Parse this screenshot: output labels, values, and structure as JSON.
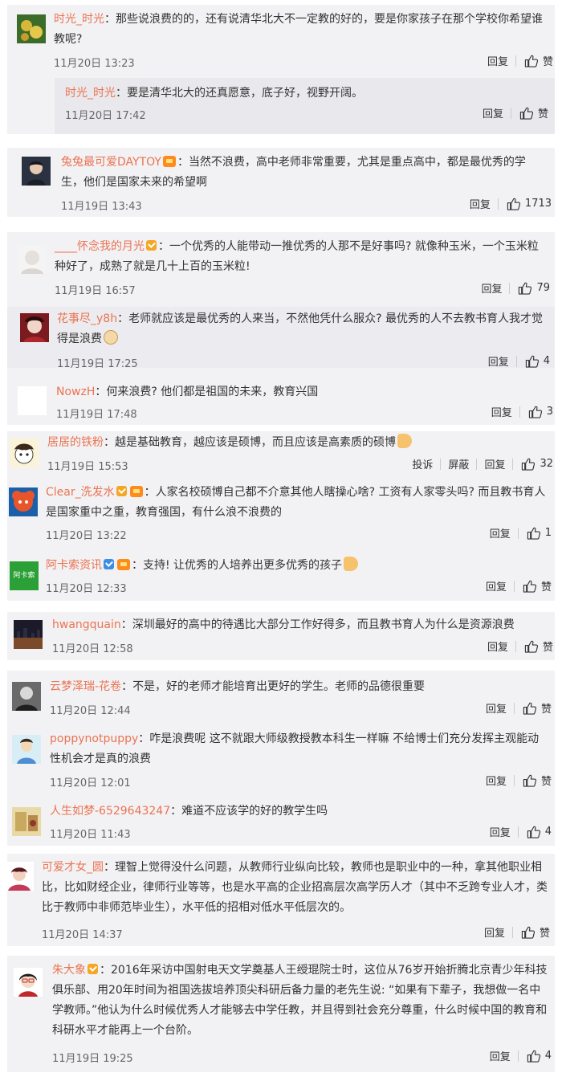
{
  "action_reply": "回复",
  "action_report": "投诉",
  "action_block": "屏蔽",
  "comments": [
    {
      "user": "时光_时光",
      "text": "那些说浪费的的，还有说清华北大不一定教的好的，要是你家孩子在那个学校你希望谁教呢?",
      "time": "11月20日 13:23",
      "likes": "赞"
    },
    {
      "user": "时光_时光",
      "text": "要是清华北大的还真愿意，底子好，视野开阔。",
      "time": "11月20日 17:42",
      "likes": "赞"
    },
    {
      "user": "兔兔最可爱DAYTOY",
      "text": "当然不浪费，高中老师非常重要，尤其是重点高中，都是最优秀的学生，他们是国家未来的希望啊",
      "time": "11月19日 13:43",
      "likes": "1713"
    },
    {
      "user": "____怀念我的月光",
      "text": "一个优秀的人能带动一推优秀的人那不是好事吗? 就像种玉米，一个玉米粒种好了，成熟了就是几十上百的玉米粒!",
      "time": "11月19日 16:57",
      "likes": "79"
    },
    {
      "user": "花事尽_y8h",
      "text": "老师就应该是最优秀的人来当，不然他凭什么服众? 最优秀的人不去教书育人我才觉得是浪费",
      "time": "11月19日 17:25",
      "likes": "4"
    },
    {
      "user": "NowzH",
      "text": "何来浪费? 他们都是祖国的未来，教育兴国",
      "time": "11月19日 17:48",
      "likes": "3"
    },
    {
      "user": "居居的铁粉",
      "text": "越是基础教育，越应该是硕博，而且应该是高素质的硕博",
      "time": "11月19日 15:53",
      "likes": "32"
    },
    {
      "user": "Clear_洗发水",
      "text": "人家名校硕博自己都不介意其他人瞎操心啥? 工资有人家零头吗? 而且教书育人是国家重中之重，教育强国，有什么浪不浪费的",
      "time": "11月20日 13:22",
      "likes": "1"
    },
    {
      "user": "阿卡索资讯",
      "text": "支持! 让优秀的人培养出更多优秀的孩子",
      "time": "11月20日 12:33",
      "likes": "赞"
    },
    {
      "user": "hwangquain",
      "text": "深圳最好的高中的待遇比大部分工作好得多，而且教书育人为什么是资源浪费",
      "time": "11月20日 12:58",
      "likes": "赞"
    },
    {
      "user": "云梦泽瑞-花卷",
      "text": "不是，好的老师才能培育出更好的学生。老师的品德很重要",
      "time": "11月20日 12:44",
      "likes": "赞"
    },
    {
      "user": "poppynotpuppy",
      "text": "咋是浪费呢 这不就跟大师级教授教本科生一样嘛 不给博士们充分发挥主观能动性机会才是真的浪费",
      "time": "11月20日 12:01",
      "likes": "赞"
    },
    {
      "user": "人生如梦-6529643247",
      "text": "难道不应该学的好的教学生吗",
      "time": "11月20日 11:43",
      "likes": "4"
    },
    {
      "user": "可爱才女_圆",
      "text": "理智上觉得没什么问题，从教师行业纵向比较，教师也是职业中的一种，拿其他职业相比，比如财经企业，律师行业等等，也是水平高的企业招高层次高学历人才（其中不乏跨专业人才，类比于教师中非师范毕业生），水平低的招相对低水平低层次的。",
      "time": "11月20日 14:37",
      "likes": "赞"
    },
    {
      "user": "朱大象",
      "text": "2016年采访中国射电天文学奠基人王绶琨院士时，这位从76岁开始折腾北京青少年科技俱乐部、用20年时间为祖国选拔培养顶尖科研后备力量的老先生说: “如果有下辈子，我想做一名中学教师。”他认为什么时候优秀人才能够去中学任教，并且得到社会充分尊重，什么时候中国的教育和科研水平才能再上一个台阶。",
      "time": "11月19日 19:25",
      "likes": "4"
    }
  ],
  "avatar_labels": {
    "akasuo": "阿卡索"
  },
  "colors": {
    "username": "#eb7350",
    "card_bg": "#f2f2f5",
    "reply_bg": "#e9e9ed",
    "text": "#333333",
    "meta": "#666666"
  }
}
